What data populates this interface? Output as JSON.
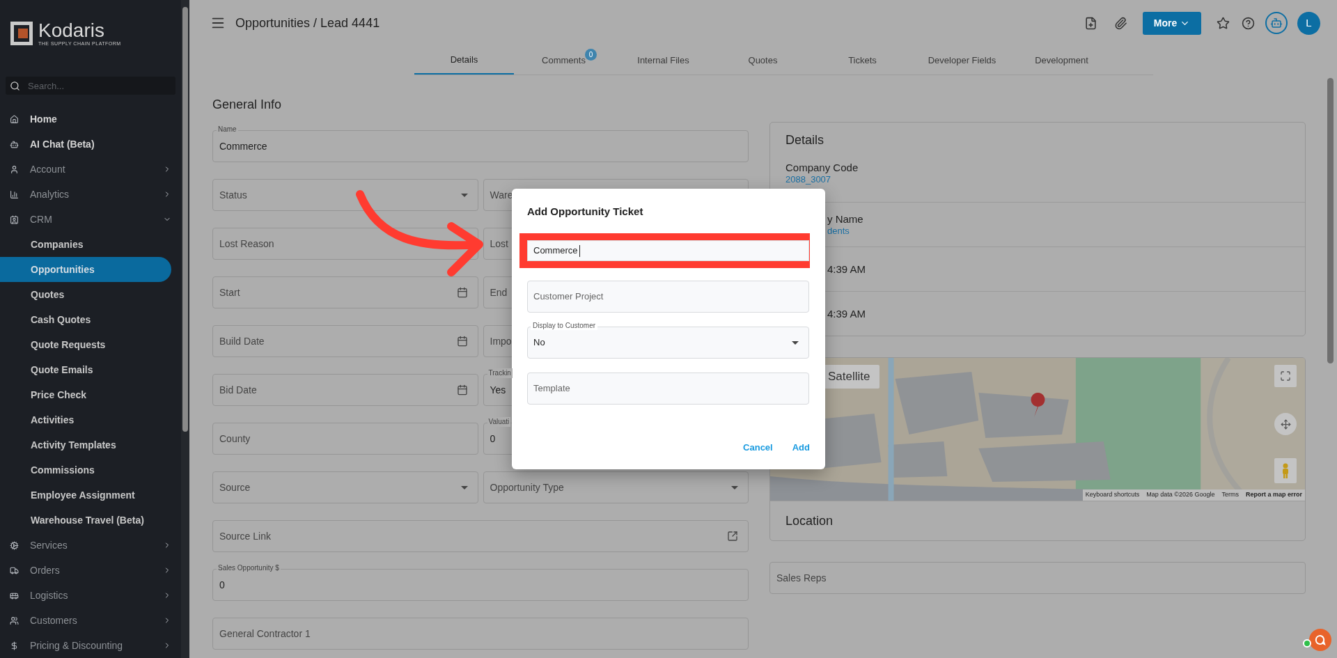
{
  "sidebar": {
    "logo": {
      "name": "Kodaris",
      "tagline": "THE SUPPLY CHAIN PLATFORM"
    },
    "search": {
      "placeholder": "Search..."
    },
    "items": [
      {
        "label": "Home",
        "kind": "link",
        "selected": false
      },
      {
        "label": "AI Chat (Beta)",
        "kind": "link",
        "selected": false
      },
      {
        "label": "Account",
        "kind": "group",
        "expanded": false,
        "selected": false
      },
      {
        "label": "Analytics",
        "kind": "group",
        "expanded": false,
        "selected": false
      },
      {
        "label": "CRM",
        "kind": "group",
        "expanded": true,
        "selected": false,
        "children": [
          {
            "label": "Companies",
            "selected": false
          },
          {
            "label": "Opportunities",
            "selected": true
          },
          {
            "label": "Quotes",
            "selected": false
          },
          {
            "label": "Cash Quotes",
            "selected": false
          },
          {
            "label": "Quote Requests",
            "selected": false
          },
          {
            "label": "Quote Emails",
            "selected": false
          },
          {
            "label": "Price Check",
            "selected": false
          },
          {
            "label": "Activities",
            "selected": false
          },
          {
            "label": "Activity Templates",
            "selected": false
          },
          {
            "label": "Commissions",
            "selected": false
          },
          {
            "label": "Employee Assignment",
            "selected": false
          },
          {
            "label": "Warehouse Travel (Beta)",
            "selected": false
          }
        ]
      },
      {
        "label": "Services",
        "kind": "group",
        "expanded": false,
        "selected": false
      },
      {
        "label": "Orders",
        "kind": "group",
        "expanded": false,
        "selected": false
      },
      {
        "label": "Logistics",
        "kind": "group",
        "expanded": false,
        "selected": false
      },
      {
        "label": "Customers",
        "kind": "group",
        "expanded": false,
        "selected": false
      },
      {
        "label": "Pricing & Discounting",
        "kind": "group",
        "expanded": false,
        "selected": false
      }
    ]
  },
  "header": {
    "title": "Opportunities / Lead 4441",
    "more_button": "More",
    "avatar": "L"
  },
  "tabs": [
    {
      "label": "Details",
      "selected": true
    },
    {
      "label": "Comments",
      "selected": false,
      "badge": "0"
    },
    {
      "label": "Internal Files",
      "selected": false
    },
    {
      "label": "Quotes",
      "selected": false
    },
    {
      "label": "Tickets",
      "selected": false
    },
    {
      "label": "Developer Fields",
      "selected": false
    },
    {
      "label": "Development",
      "selected": false
    }
  ],
  "general_info": {
    "title": "General Info",
    "rows": [
      [
        {
          "kind": "text",
          "label": "Name",
          "value": "Commerce"
        }
      ],
      [
        {
          "kind": "select",
          "placeholder": "Status"
        },
        {
          "kind": "text",
          "placeholder": "Ware"
        }
      ],
      [
        {
          "kind": "select",
          "placeholder": "Lost Reason"
        },
        {
          "kind": "text",
          "placeholder": "Lost"
        }
      ],
      [
        {
          "kind": "date",
          "placeholder": "Start"
        },
        {
          "kind": "text",
          "placeholder": "End"
        }
      ],
      [
        {
          "kind": "date",
          "placeholder": "Build Date"
        },
        {
          "kind": "text",
          "placeholder": "Impo"
        }
      ],
      [
        {
          "kind": "date",
          "placeholder": "Bid Date"
        },
        {
          "kind": "text",
          "label": "Trackin",
          "value": "Yes"
        }
      ],
      [
        {
          "kind": "text",
          "placeholder": "County"
        },
        {
          "kind": "text",
          "label": "Valuati",
          "value": "0"
        }
      ],
      [
        {
          "kind": "select",
          "placeholder": "Source"
        },
        {
          "kind": "select",
          "placeholder": "Opportunity Type"
        }
      ],
      [
        {
          "kind": "link",
          "placeholder": "Source Link"
        }
      ],
      [
        {
          "kind": "text",
          "label": "Sales Opportunity $",
          "value": "0"
        }
      ],
      [
        {
          "kind": "text",
          "placeholder": "General Contractor 1"
        }
      ]
    ]
  },
  "details_card": {
    "title": "Details",
    "rows": [
      {
        "label": "Company Code",
        "value": "2088_3007",
        "partly_hidden": false
      },
      {
        "label": "y Name",
        "value": "dents",
        "partly_hidden": true
      },
      {
        "value": "4:39 AM",
        "partly_hidden": true
      },
      {
        "value": "4:39 AM",
        "partly_hidden": true
      }
    ]
  },
  "map": {
    "kind": "picture",
    "map_type_button": "Satellite",
    "attribution": [
      "Keyboard shortcuts",
      "Map data ©2026 Google",
      "Terms",
      "Report a map error"
    ]
  },
  "location": {
    "title": "Location"
  },
  "sales_reps": {
    "placeholder": "Sales Reps"
  },
  "dialog": {
    "title": "Add Opportunity Ticket",
    "fields": [
      {
        "kind": "text",
        "value": "Commerce",
        "highlighted": true
      },
      {
        "kind": "text",
        "placeholder": "Customer Project",
        "highlighted": false
      },
      {
        "kind": "select",
        "label": "Display to Customer",
        "value": "No",
        "highlighted": false
      },
      {
        "kind": "text",
        "placeholder": "Template",
        "highlighted": false
      }
    ],
    "buttons": [
      "Cancel",
      "Add"
    ]
  }
}
